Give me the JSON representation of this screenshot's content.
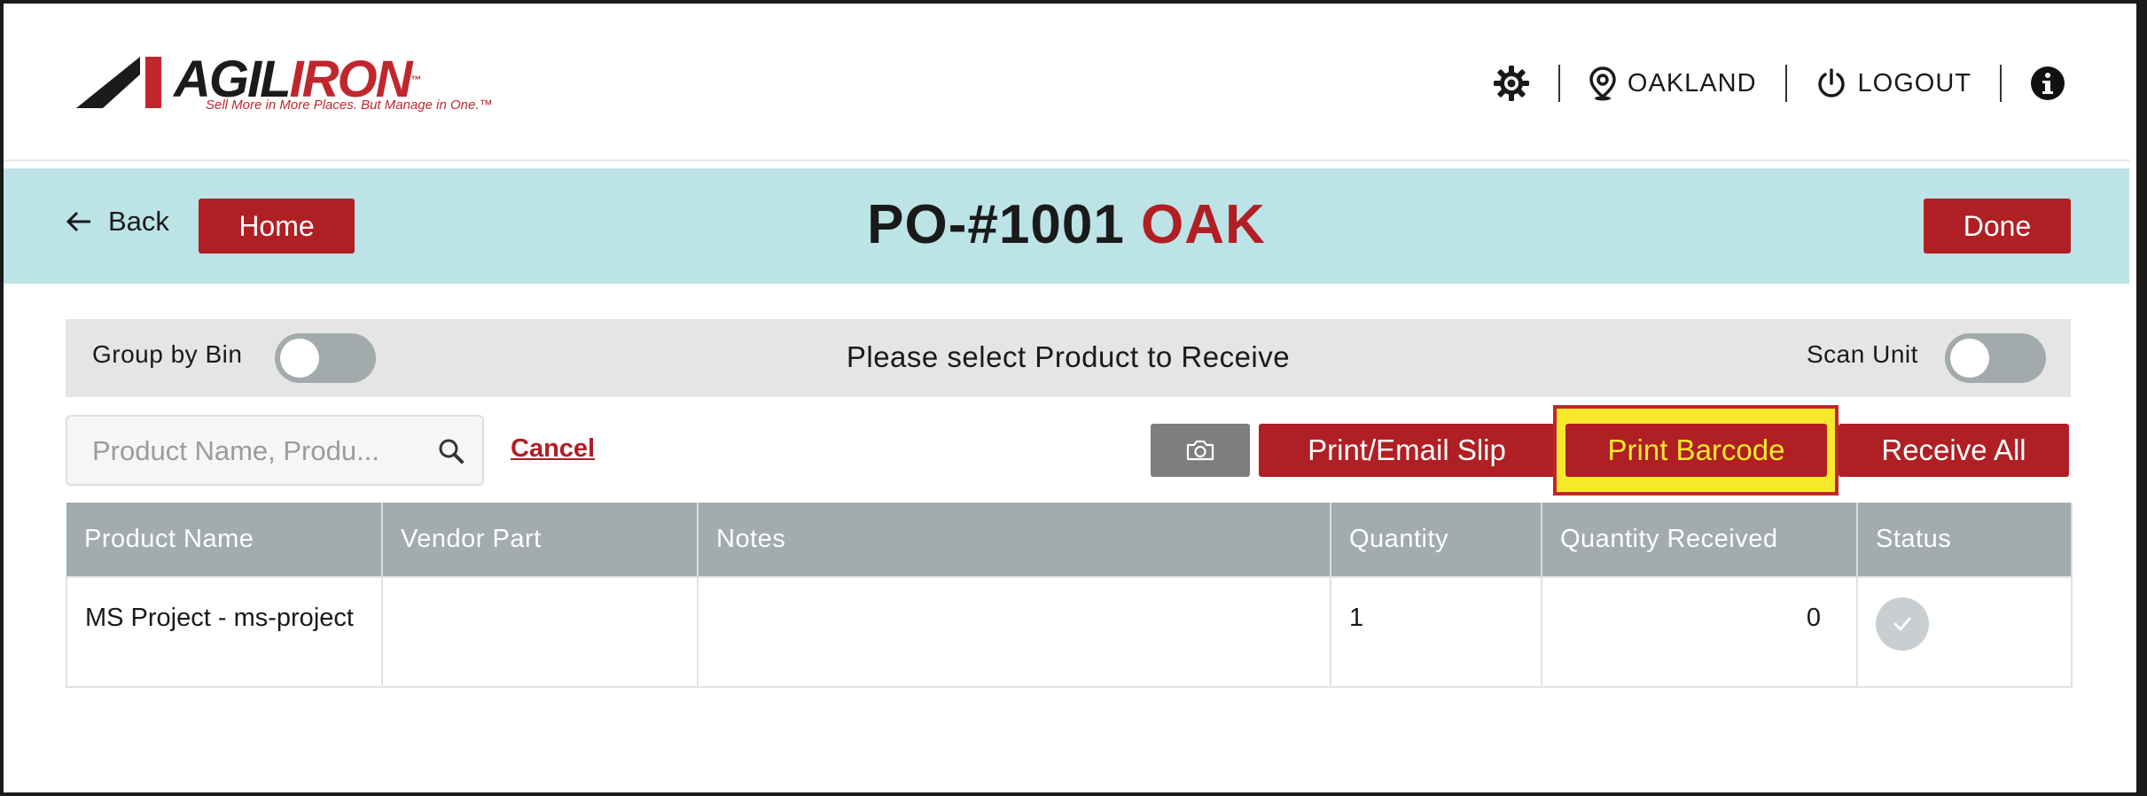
{
  "brand": {
    "logo_word_1": "AGIL",
    "logo_word_2": "IRON",
    "tagline": "Sell More in More Places. But Manage in One.™",
    "colors": {
      "brand_red": "#b01f24",
      "title_band": "#bce3e6",
      "table_header": "#a2abae",
      "highlight_yellow": "#f6e92c"
    }
  },
  "topnav": {
    "settings_icon": "gear-icon",
    "location_icon": "map-pin-icon",
    "location_label": "OAKLAND",
    "logout_icon": "power-icon",
    "logout_label": "LOGOUT",
    "info_icon": "info-icon"
  },
  "titlebar": {
    "back_label": "Back",
    "home_label": "Home",
    "po_number": "PO-#1001",
    "po_location": "OAK",
    "done_label": "Done"
  },
  "filterbar": {
    "group_by_bin_label": "Group by Bin",
    "group_by_bin_on": false,
    "instruction": "Please select Product to Receive",
    "scan_unit_label": "Scan Unit",
    "scan_unit_on": false
  },
  "actions": {
    "search_placeholder": "Product Name, Produ...",
    "search_value": "",
    "cancel_label": "Cancel",
    "camera_icon": "camera-icon",
    "print_email_slip_label": "Print/Email Slip",
    "print_barcode_label": "Print Barcode",
    "receive_all_label": "Receive All"
  },
  "table": {
    "columns": [
      "Product Name",
      "Vendor Part",
      "Notes",
      "Quantity",
      "Quantity Received",
      "Status"
    ],
    "rows": [
      {
        "product_name": "MS Project - ms-project",
        "vendor_part": "",
        "notes": "",
        "quantity": "1",
        "quantity_received": "0",
        "status_icon": "check-circle-icon"
      }
    ]
  }
}
